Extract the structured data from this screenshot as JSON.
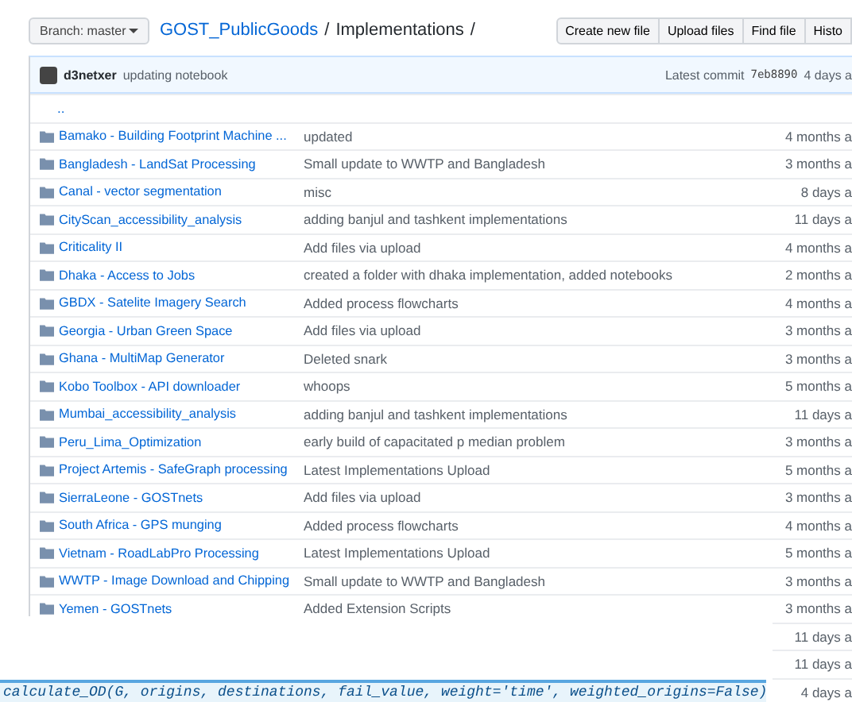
{
  "header": {
    "branch_button": "Branch: master",
    "breadcrumb": {
      "repo": "GOST_PublicGoods",
      "separator_1": "/",
      "folder": "Implementations",
      "separator_2": "/"
    },
    "buttons": [
      "Create new file",
      "Upload files",
      "Find file",
      "Histo"
    ]
  },
  "commit_bar": {
    "author": "d3netxer",
    "message": "updating notebook",
    "latest_label": "Latest commit",
    "sha": "7eb8890",
    "age": "4 days a"
  },
  "parent_link": "..",
  "rows": [
    {
      "name": "Bamako - Building Footprint Machine ...",
      "message": "updated",
      "age": "4 months a"
    },
    {
      "name": "Bangladesh - LandSat Processing",
      "message": "Small update to WWTP and Bangladesh",
      "age": "3 months a"
    },
    {
      "name": "Canal - vector segmentation",
      "message": "misc",
      "age": "8 days a"
    },
    {
      "name": "CityScan_accessibility_analysis",
      "message": "adding banjul and tashkent implementations",
      "age": "11 days a"
    },
    {
      "name": "Criticality II",
      "message": "Add files via upload",
      "age": "4 months a"
    },
    {
      "name": "Dhaka - Access to Jobs",
      "message": "created a folder with dhaka implementation, added notebooks",
      "age": "2 months a"
    },
    {
      "name": "GBDX - Satelite Imagery Search",
      "message": "Added process flowcharts",
      "age": "4 months a"
    },
    {
      "name": "Georgia - Urban Green Space",
      "message": "Add files via upload",
      "age": "3 months a"
    },
    {
      "name": "Ghana - MultiMap Generator",
      "message": "Deleted snark",
      "age": "3 months a"
    },
    {
      "name": "Kobo Toolbox - API downloader",
      "message": "whoops",
      "age": "5 months a"
    },
    {
      "name": "Mumbai_accessibility_analysis",
      "message": "adding banjul and tashkent implementations",
      "age": "11 days a"
    },
    {
      "name": "Peru_Lima_Optimization",
      "message": "early build of capacitated p median problem",
      "age": "3 months a"
    },
    {
      "name": "Project Artemis - SafeGraph processing",
      "message": "Latest Implementations Upload",
      "age": "5 months a"
    },
    {
      "name": "SierraLeone - GOSTnets",
      "message": "Add files via upload",
      "age": "3 months a"
    },
    {
      "name": "South Africa - GPS munging",
      "message": "Added process flowcharts",
      "age": "4 months a"
    },
    {
      "name": "Vietnam - RoadLabPro Processing",
      "message": "Latest Implementations Upload",
      "age": "5 months a"
    },
    {
      "name": "WWTP - Image Download and Chipping",
      "message": "Small update to WWTP and Bangladesh",
      "age": "3 months a"
    },
    {
      "name": "Yemen - GOSTnets",
      "message": "Added Extension Scripts",
      "age": "3 months a"
    }
  ],
  "covered_rows": [
    {
      "age": "11 days a"
    },
    {
      "age": "11 days a"
    },
    {
      "age": "4 days a"
    }
  ],
  "overlay_panel": {
    "code_line": "calculate_OD(G, origins, destinations, fail_value, weight='time', weighted_origins=False)"
  }
}
